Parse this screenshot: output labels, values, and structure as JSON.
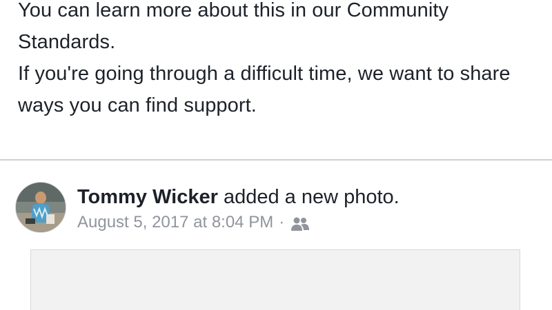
{
  "notice": {
    "line1": "You can learn more about this in our Community Standards.",
    "line2": "If you're going through a difficult time, we want to share ways you can find support."
  },
  "post": {
    "author": "Tommy Wicker",
    "action": " added a new photo.",
    "timestamp": "August 5, 2017 at 8:04 PM",
    "separator": "·",
    "audience_icon": "friends-icon"
  },
  "colors": {
    "text": "#1d2129",
    "meta": "#90949c",
    "divider": "#cdd0d4",
    "photo_bg": "#f2f2f2"
  }
}
